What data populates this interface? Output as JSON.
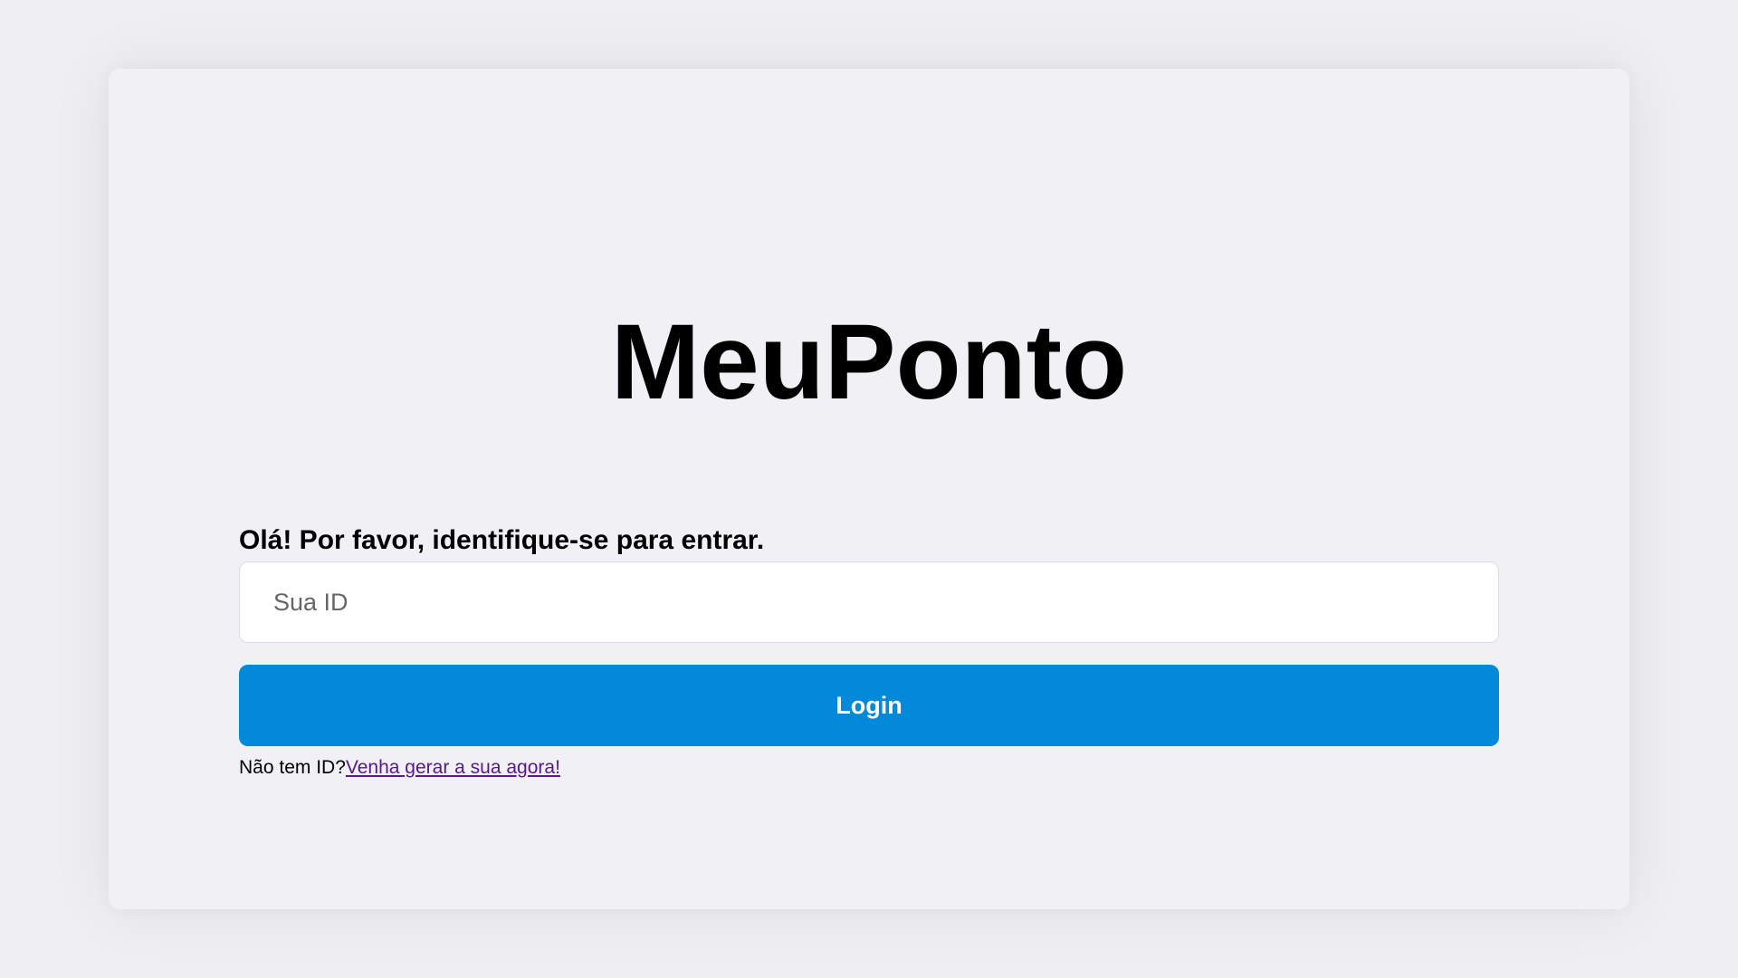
{
  "app": {
    "title": "MeuPonto"
  },
  "login": {
    "prompt": "Olá! Por favor, identifique-se para entrar.",
    "id_value": "",
    "id_placeholder": "Sua ID",
    "button_label": "Login",
    "no_id_text": "Não tem ID?",
    "signup_link": "Venha gerar a sua agora!"
  },
  "colors": {
    "page_background": "#efeff3",
    "card_background": "#f0f0f5",
    "button_background": "#0289da",
    "button_text": "#ffffff",
    "link": "#551a8b"
  }
}
